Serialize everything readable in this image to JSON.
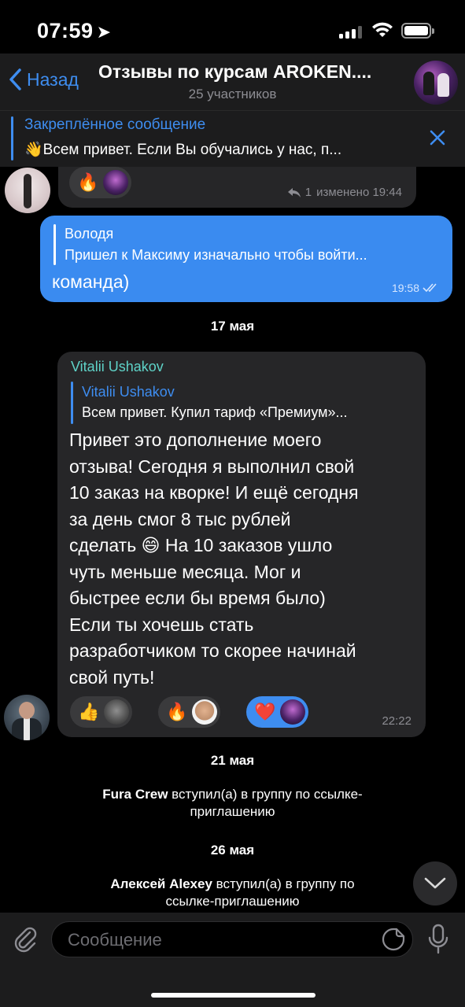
{
  "status_bar": {
    "time": "07:59",
    "location_icon": "navigation-arrow-icon",
    "icons": [
      "signal-icon",
      "wifi-icon",
      "battery-icon"
    ]
  },
  "header": {
    "back_label": "Назад",
    "title": "Отзывы по курсам AROKEN....",
    "subtitle": "25 участников"
  },
  "pinned": {
    "title": "Закреплённое сообщение",
    "text": "👋Всем привет.  Если Вы обучались у нас, п..."
  },
  "messages": {
    "m1": {
      "reaction_emoji": "🔥",
      "reply_count": "1",
      "edited_time": "изменено 19:44"
    },
    "m2": {
      "reply_name": "Володя",
      "reply_text": "Пришел к Максиму изначально чтобы войти...",
      "text": "команда)",
      "time": "19:58"
    },
    "date1": "17 мая",
    "m3": {
      "sender": "Vitalii Ushakov",
      "reply_name": "Vitalii Ushakov",
      "reply_text": "Всем привет. Купил тариф «Премиум»...",
      "text": "Привет это дополнение моего\nотзыва! Сегодня я выполнил свой\n10 заказ на кворке! И ещё сегодня\nза день смог 8 тыс рублей\nсделать 😄 На 10 заказов ушло\nчуть меньше месяца. Мог и\nбыстрее если бы время было)\nЕсли ты хочешь стать\nразработчиком то скорее начинай\nсвой путь!",
      "reactions": [
        "👍",
        "🔥",
        "❤️"
      ],
      "time": "22:22"
    },
    "date2": "21 мая",
    "sys1": {
      "name": "Fura Crew",
      "line1": " вступил(а) в группу по ссылке-",
      "line2": "приглашению"
    },
    "date3": "26 мая",
    "sys2": {
      "name": "Алексей Alexey",
      "line1": " вступил(а) в группу по",
      "line2": "ссылке-приглашению"
    }
  },
  "input": {
    "placeholder": "Сообщение"
  },
  "colors": {
    "accent": "#3e8df0",
    "outgoing_bubble": "#3a8bf0",
    "incoming_bubble": "#262628",
    "sender_name": "#5fd3c8"
  }
}
